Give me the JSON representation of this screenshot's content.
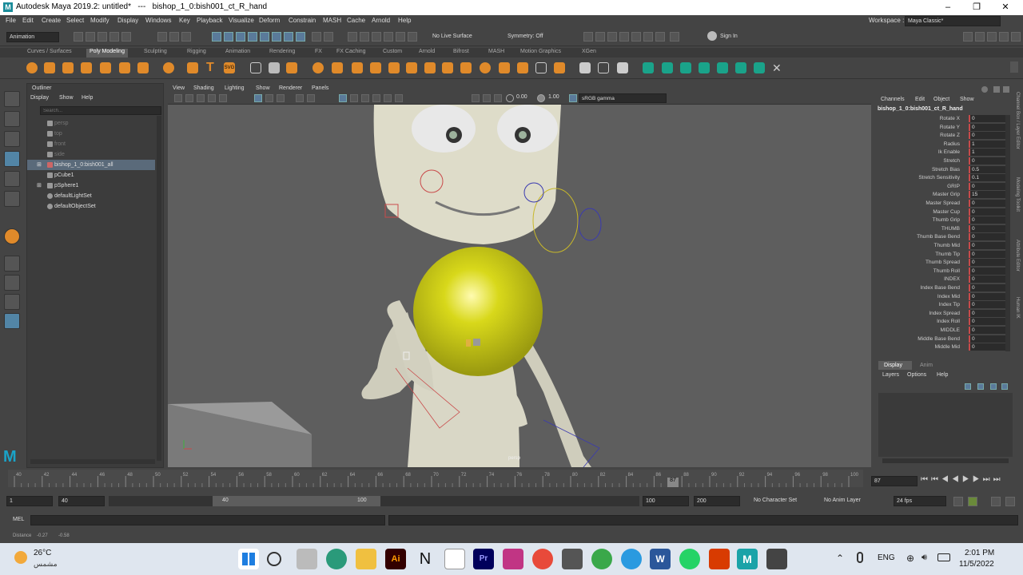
{
  "window": {
    "title": "Autodesk Maya 2019.2: untitled*   ---   bishop_1_0:bish001_ct_R_hand",
    "logo": "M",
    "minimize": "–",
    "restore": "❐",
    "close": "✕"
  },
  "menu": [
    "File",
    "Edit",
    "Create",
    "Select",
    "Modify",
    "Display",
    "Windows",
    "Key",
    "Playback",
    "Visualize",
    "Deform",
    "Constrain",
    "MASH",
    "Cache",
    "Arnold",
    "Help"
  ],
  "workspace": {
    "label": "Workspace :",
    "value": "Maya Classic*"
  },
  "status": {
    "mode": "Animation",
    "live_surface": "No Live Surface",
    "symmetry": "Symmetry: Off",
    "sign_in": "Sign In"
  },
  "shelf_tabs": [
    "Curves / Surfaces",
    "Poly Modeling",
    "Sculpting",
    "Rigging",
    "Animation",
    "Rendering",
    "FX",
    "FX Caching",
    "Custom",
    "Arnold",
    "Bifrost",
    "MASH",
    "Motion Graphics",
    "XGen"
  ],
  "active_shelf": "Poly Modeling",
  "outliner": {
    "title": "Outliner",
    "menus": [
      "Display",
      "Show",
      "Help"
    ],
    "search_placeholder": "Search...",
    "items": [
      {
        "label": "persp",
        "dim": true
      },
      {
        "label": "top",
        "dim": true
      },
      {
        "label": "front",
        "dim": true
      },
      {
        "label": "side",
        "dim": true
      },
      {
        "label": "bishop_1_0:bish001_all",
        "selected": true,
        "expand": "⊞"
      },
      {
        "label": "pCube1"
      },
      {
        "label": "pSphere1",
        "expand": "⊞"
      },
      {
        "label": "defaultLightSet"
      },
      {
        "label": "defaultObjectSet"
      }
    ]
  },
  "viewport": {
    "menus": [
      "View",
      "Shading",
      "Lighting",
      "Show",
      "Renderer",
      "Panels"
    ],
    "exposure": "0.00",
    "gamma": "1.00",
    "color_space": "sRGB gamma",
    "camera_label": "persp",
    "sphere_color": "#d8d81a"
  },
  "channel_box": {
    "menus": [
      "Channels",
      "Edit",
      "Object",
      "Show"
    ],
    "object": "bishop_1_0:bish001_ct_R_hand",
    "channels": [
      {
        "name": "Rotate X",
        "value": "0"
      },
      {
        "name": "Rotate Y",
        "value": "0"
      },
      {
        "name": "Rotate Z",
        "value": "0"
      },
      {
        "name": "Radius",
        "value": "1"
      },
      {
        "name": "Ik Enable",
        "value": "1"
      },
      {
        "name": "Stretch",
        "value": "0"
      },
      {
        "name": "Stretch Bias",
        "value": "0.5"
      },
      {
        "name": "Stretch Sensitivity",
        "value": "0.1"
      },
      {
        "name": "GRIP",
        "value": "0"
      },
      {
        "name": "Master Grip",
        "value": "15"
      },
      {
        "name": "Master Spread",
        "value": "0"
      },
      {
        "name": "Master Cup",
        "value": "0"
      },
      {
        "name": "Thumb Grip",
        "value": "0"
      },
      {
        "name": "THUMB",
        "value": "0"
      },
      {
        "name": "Thumb Base Bend",
        "value": "0"
      },
      {
        "name": "Thumb Mid",
        "value": "0"
      },
      {
        "name": "Thumb Tip",
        "value": "0"
      },
      {
        "name": "Thumb Spread",
        "value": "0"
      },
      {
        "name": "Thumb Roll",
        "value": "0"
      },
      {
        "name": "INDEX",
        "value": "0"
      },
      {
        "name": "Index Base Bend",
        "value": "0"
      },
      {
        "name": "Index Mid",
        "value": "0"
      },
      {
        "name": "Index Tip",
        "value": "0"
      },
      {
        "name": "Index Spread",
        "value": "0"
      },
      {
        "name": "Index Roll",
        "value": "0"
      },
      {
        "name": "MIDDLE",
        "value": "0"
      },
      {
        "name": "Middle Base Bend",
        "value": "0"
      },
      {
        "name": "Middle Mid",
        "value": "0"
      }
    ],
    "side_tabs": [
      "Channel Box / Layer Editor",
      "Modeling Toolkit",
      "Attribute Editor",
      "Human IK"
    ]
  },
  "layer_editor": {
    "tabs": [
      "Display",
      "Anim"
    ],
    "menus": [
      "Layers",
      "Options",
      "Help"
    ]
  },
  "timeline": {
    "ticks": [
      "40",
      "42",
      "44",
      "46",
      "48",
      "50",
      "52",
      "54",
      "56",
      "58",
      "60",
      "62",
      "64",
      "66",
      "68",
      "70",
      "72",
      "74",
      "76",
      "78",
      "80",
      "82",
      "84",
      "86",
      "88",
      "90",
      "92",
      "94",
      "96",
      "98",
      "100"
    ],
    "current_frame": "87",
    "frame_field": "87"
  },
  "range": {
    "start": "1",
    "inner_start": "40",
    "slider_start": "40",
    "slider_end": "100",
    "inner_end": "100",
    "end": "200",
    "character_set": "No Character Set",
    "anim_layer": "No Anim Layer",
    "fps": "24 fps"
  },
  "command": {
    "label": "MEL"
  },
  "help": {
    "text": "Distance    -0.27        -0.58"
  },
  "taskbar": {
    "weather_temp": "26°C",
    "weather_desc": "مشمس",
    "lang": "ENG",
    "time": "2:01 PM",
    "date": "11/5/2022",
    "apps": [
      "windows-start",
      "search",
      "task-view",
      "edge",
      "file-explorer",
      "illustrator",
      "notion",
      "calendar",
      "premiere",
      "instagram",
      "chrome",
      "calculator",
      "chrome-2",
      "telegram",
      "word",
      "whatsapp",
      "office",
      "maya",
      "remote"
    ]
  }
}
